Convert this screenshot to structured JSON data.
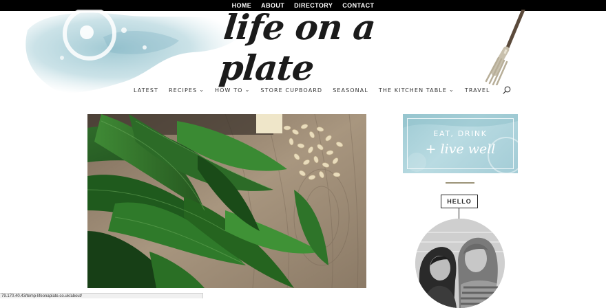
{
  "top_nav": {
    "items": [
      "HOME",
      "ABOUT",
      "DIRECTORY",
      "CONTACT"
    ]
  },
  "header": {
    "logo_text": "life on a plate"
  },
  "main_nav": {
    "items": [
      {
        "label": "LATEST",
        "has_dropdown": false
      },
      {
        "label": "RECIPES",
        "has_dropdown": true
      },
      {
        "label": "HOW TO",
        "has_dropdown": true
      },
      {
        "label": "STORE CUPBOARD",
        "has_dropdown": false
      },
      {
        "label": "SEASONAL",
        "has_dropdown": false
      },
      {
        "label": "THE KITCHEN TABLE",
        "has_dropdown": true
      },
      {
        "label": "TRAVEL",
        "has_dropdown": false
      }
    ],
    "dropdown_glyph": "⌄",
    "search_icon": "search-icon"
  },
  "sidebar": {
    "promo_line1": "EAT, DRINK",
    "promo_line2": "+ live well",
    "hello_label": "HELLO"
  },
  "status_bar": {
    "url": "79.170.40.43/temp-lifeonaplate.co.uk/about/"
  },
  "colors": {
    "top_bar": "#000000",
    "promo_bg": "#a9d1da",
    "divider": "#9b9378"
  }
}
